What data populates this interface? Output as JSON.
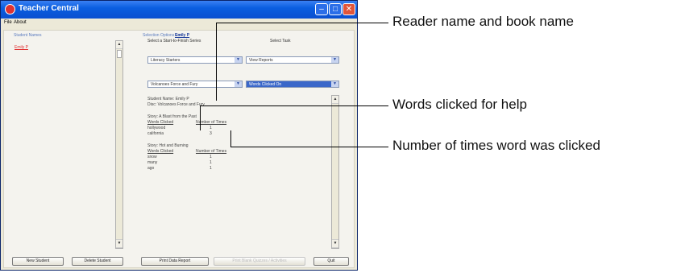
{
  "window": {
    "title": "Teacher Central",
    "menu": [
      "File",
      "About"
    ]
  },
  "students": {
    "header": "Student Names",
    "items": [
      "Emily P"
    ]
  },
  "selection": {
    "label": "Selection Options For",
    "student": "Emily P",
    "series_label": "Select a Start-to-Finish Series",
    "task_label": "Select Task",
    "series_value": "Literacy Starters",
    "task_value": "View Reports",
    "book_value": "Volcanoes Force and Fury",
    "report_value": "Words Clicked On"
  },
  "report": {
    "student_line": "Student Name: Emily P",
    "disc_line": "Disc: Volcanoes Force and Fury",
    "stories": [
      {
        "title": "Story: A Blast from the Past",
        "col_word": "Words Clicked",
        "col_times": "Number of Times",
        "rows": [
          [
            "hollywood",
            "1"
          ],
          [
            "california",
            "3"
          ]
        ]
      },
      {
        "title": "Story: Hot and Burning",
        "col_word": "Words Clicked",
        "col_times": "Number of Times",
        "rows": [
          [
            "snow",
            "1"
          ],
          [
            "many",
            "1"
          ],
          [
            "ago",
            "1"
          ]
        ]
      }
    ]
  },
  "buttons": {
    "new_student": "New Student",
    "delete_student": "Delete Student",
    "print_report": "Print Data Report",
    "print_quizzes": "Print Blank Quizzes / Activities",
    "quit": "Quit"
  },
  "callouts": {
    "reader_book": "Reader name and book name",
    "words_clicked": "Words clicked for help",
    "times_clicked": "Number of times word was clicked"
  }
}
